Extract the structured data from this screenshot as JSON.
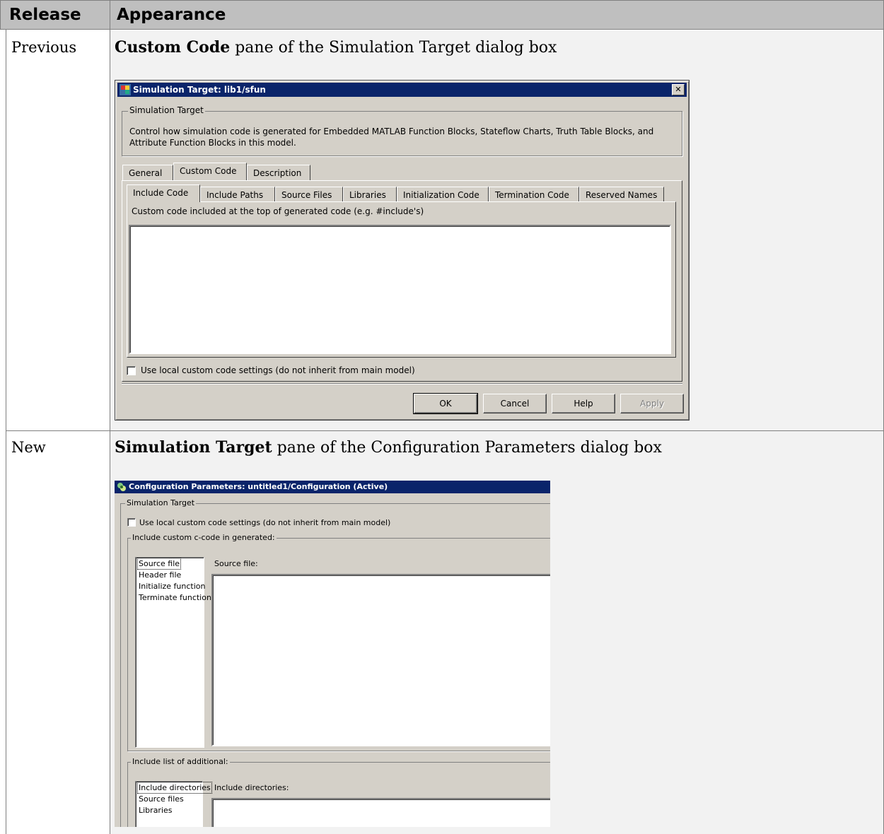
{
  "table": {
    "header": {
      "release": "Release",
      "appearance": "Appearance"
    },
    "rows": [
      {
        "release": "Previous",
        "caption_bold": "Custom Code",
        "caption_rest": " pane of the Simulation Target dialog box"
      },
      {
        "release": "New",
        "caption_bold": "Simulation Target",
        "caption_rest": " pane of the Configuration Parameters dialog box"
      }
    ]
  },
  "dialog1": {
    "title": "Simulation Target: lib1/sfun",
    "close_glyph": "✕",
    "group_title": "Simulation Target",
    "description": "Control how simulation code is generated for Embedded MATLAB Function Blocks, Stateflow Charts, Truth Table Blocks, and Attribute Function Blocks in this model.",
    "tabs": [
      "General",
      "Custom Code",
      "Description"
    ],
    "subtabs": [
      "Include Code",
      "Include Paths",
      "Source Files",
      "Libraries",
      "Initialization Code",
      "Termination Code",
      "Reserved Names"
    ],
    "textarea_label": "Custom code included at the top of generated code (e.g. #include's)",
    "checkbox_label": "Use local custom code settings (do not inherit from main model)",
    "buttons": {
      "ok": "OK",
      "cancel": "Cancel",
      "help": "Help",
      "apply": "Apply"
    }
  },
  "dialog2": {
    "title": "Configuration Parameters: untitled1/Configuration (Active)",
    "group_title": "Simulation Target",
    "checkbox_label": "Use local custom code settings (do not inherit from main model)",
    "custom_group_title": "Include custom c-code in generated:",
    "custom_list": [
      "Source file",
      "Header file",
      "Initialize function",
      "Terminate function"
    ],
    "custom_field_label": "Source file:",
    "additional_group_title": "Include list of additional:",
    "additional_list": [
      "Include directories",
      "Source files",
      "Libraries"
    ],
    "additional_field_label": "Include directories:"
  },
  "colors": {
    "titlebar": "#0a246a",
    "dialog_face": "#d4d0c8",
    "header_bg": "#bfbfbf",
    "cell_bg": "#f2f2f2"
  }
}
